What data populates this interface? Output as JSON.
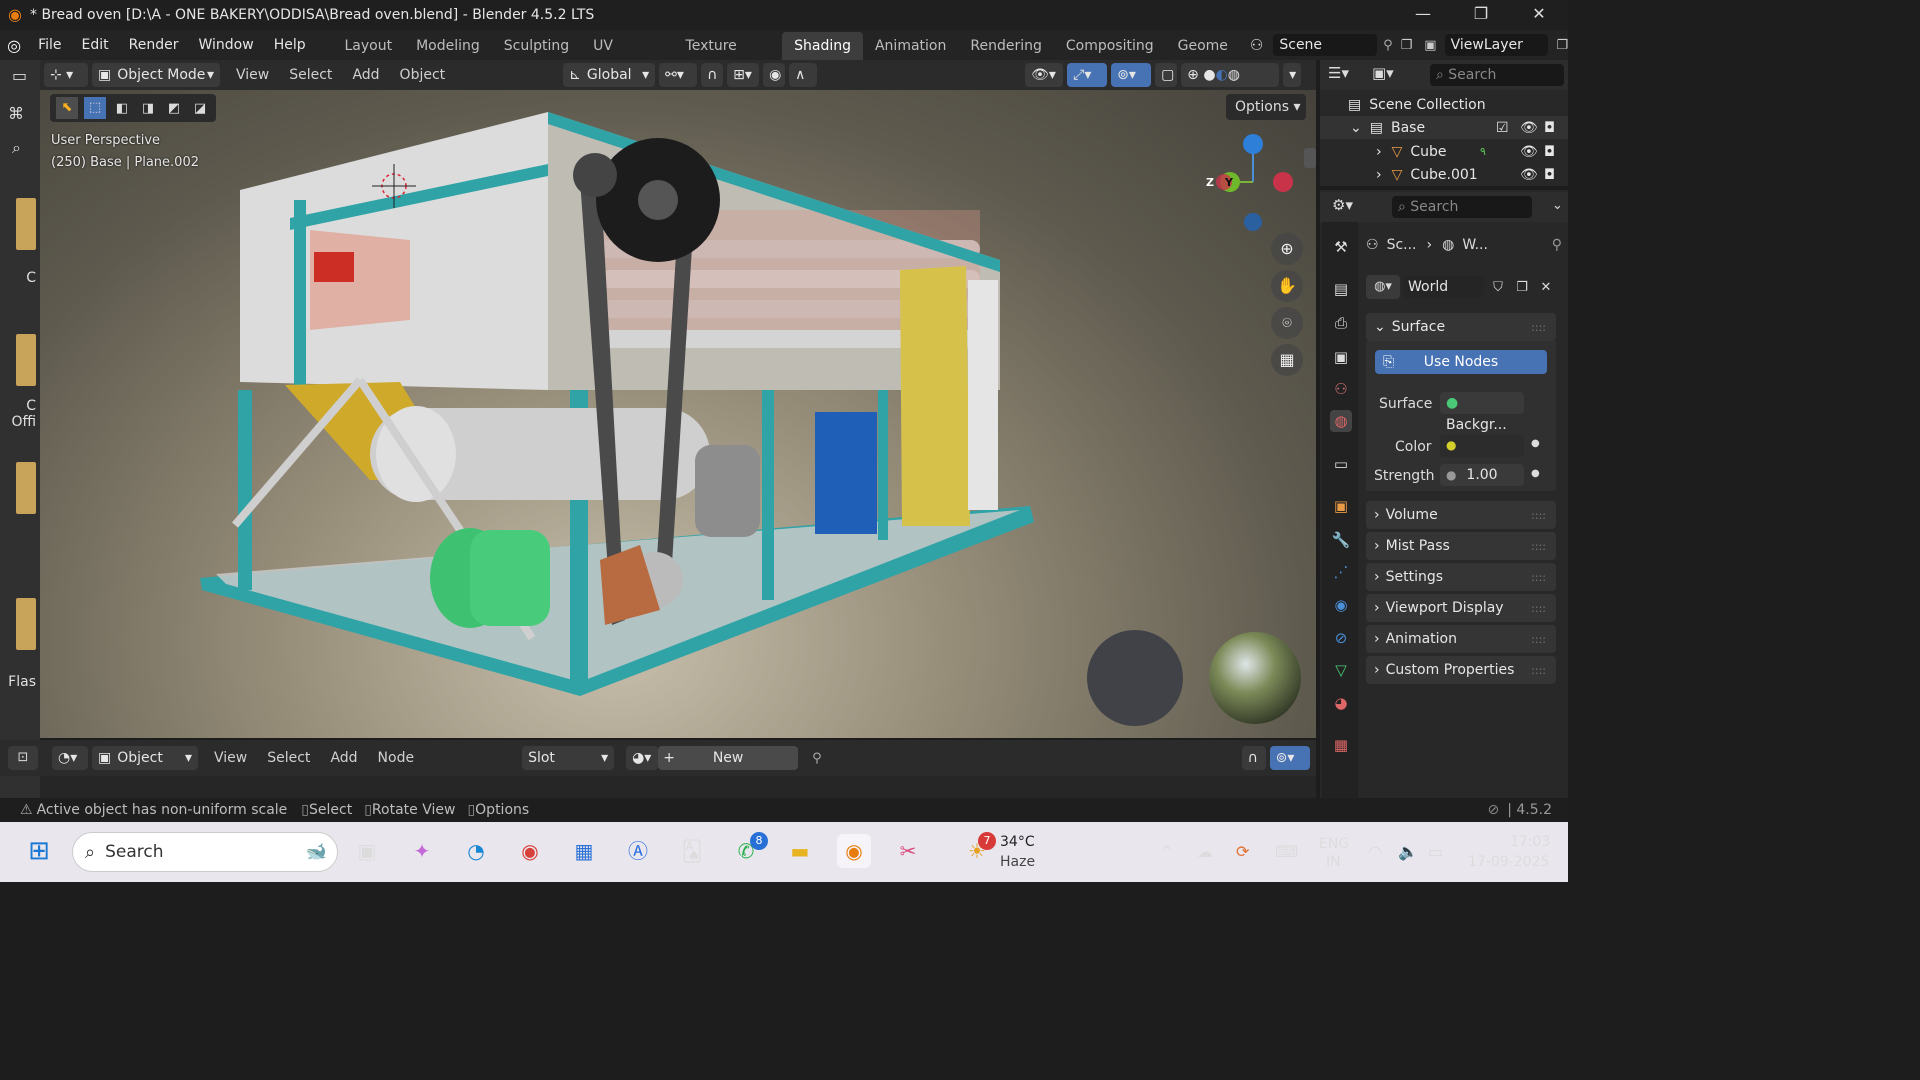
{
  "window": {
    "title": "* Bread oven [D:\\A - ONE BAKERY\\ODDISA\\Bread oven.blend] - Blender 4.5.2 LTS",
    "minimize": "—",
    "maximize": "❐",
    "close": "✕"
  },
  "menubar": {
    "items": [
      "File",
      "Edit",
      "Render",
      "Window",
      "Help"
    ]
  },
  "workspaces": {
    "tabs": [
      "Layout",
      "Modeling",
      "Sculpting",
      "UV Editing",
      "Texture Paint",
      "Shading",
      "Animation",
      "Rendering",
      "Compositing",
      "Geome"
    ],
    "active": "Shading"
  },
  "scene": {
    "name": "Scene",
    "view_layer": "ViewLayer"
  },
  "viewport_header": {
    "mode": "Object Mode",
    "menus": [
      "View",
      "Select",
      "Add",
      "Object"
    ],
    "transform_orientation": "Global",
    "options_label": "Options"
  },
  "viewport": {
    "perspective_label": "User Perspective",
    "context_label": "(250) Base | Plane.002",
    "gizmo_axes": [
      "Z",
      "Y"
    ]
  },
  "left_strip": {
    "labels": [
      "C",
      "Offi",
      "Flas"
    ]
  },
  "outliner": {
    "search_placeholder": "Search",
    "scene_collection": "Scene Collection",
    "items": [
      {
        "name": "Base"
      },
      {
        "name": "Cube"
      },
      {
        "name": "Cube.001"
      }
    ]
  },
  "properties": {
    "search_placeholder": "Search",
    "breadcrumb": [
      "Sc...",
      "W..."
    ],
    "world_name": "World",
    "surface_section": "Surface",
    "use_nodes_label": "Use Nodes",
    "surface_label": "Surface",
    "surface_value": "Backgr...",
    "color_label": "Color",
    "strength_label": "Strength",
    "strength_value": "1.00",
    "panels": [
      "Volume",
      "Mist Pass",
      "Settings",
      "Viewport Display",
      "Animation",
      "Custom Properties"
    ]
  },
  "shader_header": {
    "mode": "Object",
    "menus": [
      "View",
      "Select",
      "Add",
      "Node"
    ],
    "slot": "Slot",
    "new_label": "New"
  },
  "status_bar": {
    "warning": "Active object has non-uniform scale",
    "hints": [
      "Select",
      "Rotate View",
      "Options"
    ],
    "version": "4.5.2"
  },
  "taskbar": {
    "search_placeholder": "Search",
    "whatsapp_badge": "8",
    "weather_badge": "7",
    "temperature": "34°C",
    "weather": "Haze",
    "language_top": "ENG",
    "language_bottom": "IN",
    "time": "17:03",
    "date": "17-09-2025"
  },
  "colors": {
    "accent_blue": "#4772b3",
    "active_tab": "#3d3d3d",
    "frame_teal": "#2fa3a6",
    "blender_orange": "#e87d0d"
  }
}
